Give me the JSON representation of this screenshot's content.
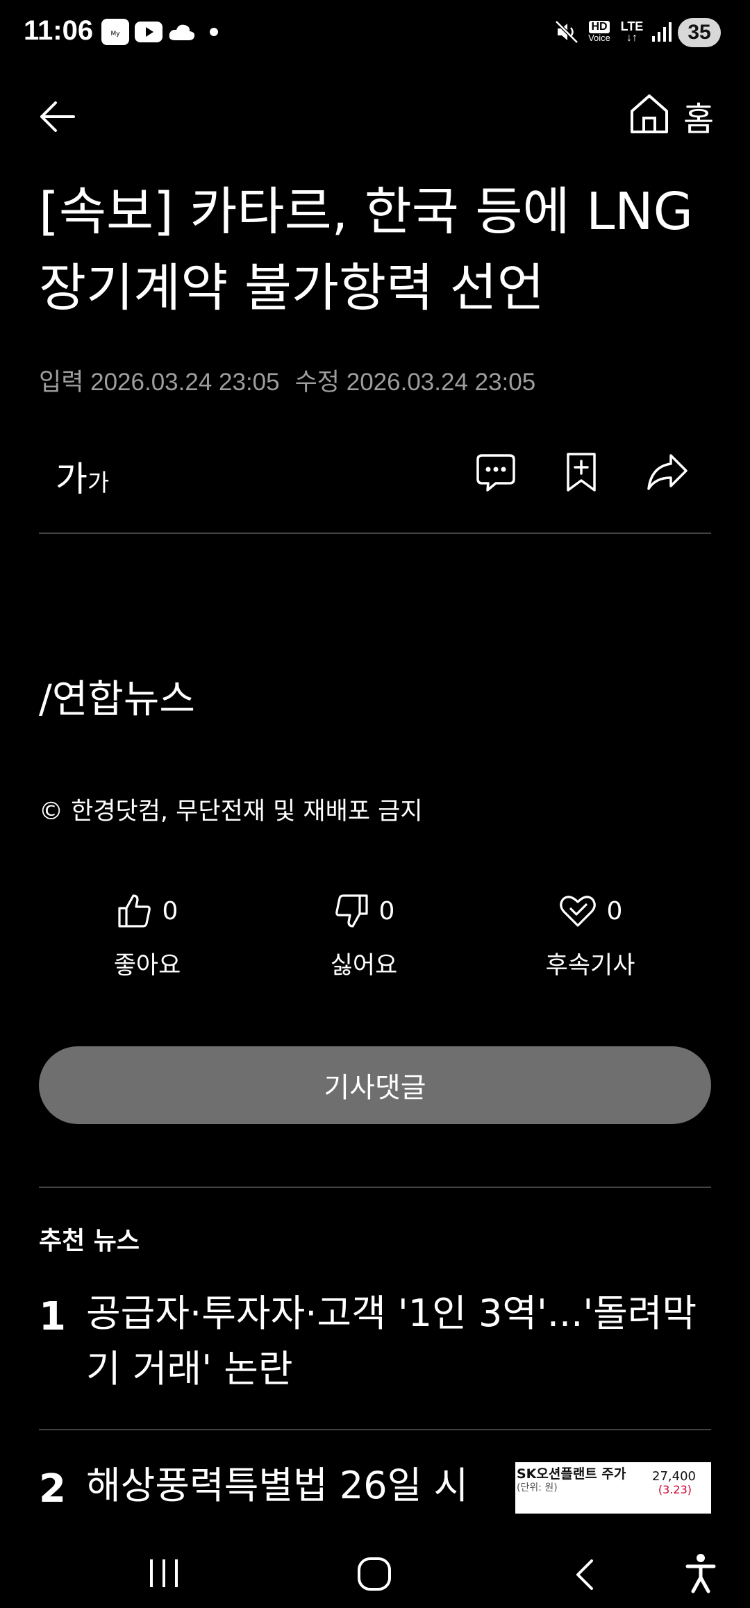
{
  "status_bar": {
    "time": "11:06",
    "app_icon_label": "My 삼성화재",
    "hd_voice": "HD Voice",
    "network": "LTE",
    "battery": "35"
  },
  "header": {
    "home_label": "홈"
  },
  "article": {
    "title": "[속보] 카타르, 한국 등에 LNG 장기계약 불가항력 선언",
    "input_date": "입력 2026.03.24 23:05",
    "edit_date": "수정 2026.03.24 23:05",
    "font_size_big": "가",
    "font_size_small": "가",
    "credit": "/연합뉴스",
    "copyright": "© 한경닷컴, 무단전재 및 재배포 금지"
  },
  "reactions": {
    "like": {
      "label": "좋아요",
      "count": "0"
    },
    "dislike": {
      "label": "싫어요",
      "count": "0"
    },
    "follow": {
      "label": "후속기사",
      "count": "0"
    }
  },
  "comment_button": "기사댓글",
  "recommended": {
    "title": "추천 뉴스",
    "items": [
      {
        "num": "1",
        "text": "공급자·투자자·고객 '1인 3역'...'돌려막기 거래' 논란"
      },
      {
        "num": "2",
        "text": "해상풍력특별법 26일 시"
      }
    ],
    "thumb": {
      "title": "SK오션플랜트 주가",
      "unit": "(단위: 원)",
      "value": "27,400",
      "date": "(3.23)"
    }
  },
  "colors": {
    "background": "#000000",
    "comment_button": "#6f6f6f",
    "meta_text": "#9e9e9e"
  }
}
